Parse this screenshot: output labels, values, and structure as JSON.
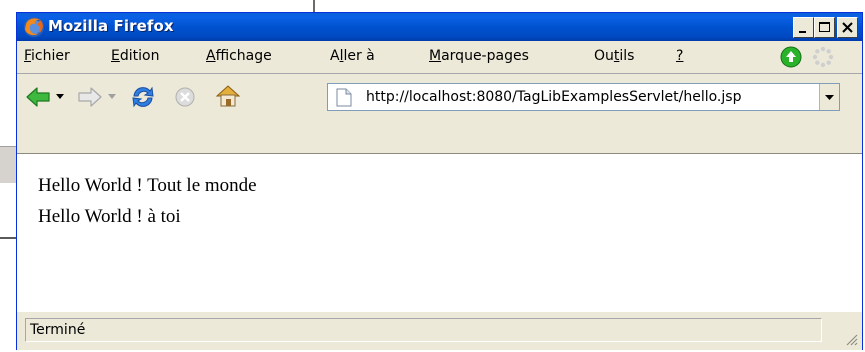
{
  "window": {
    "title": "Mozilla Firefox"
  },
  "menu": {
    "items": [
      {
        "pre": "",
        "u": "F",
        "post": "ichier"
      },
      {
        "pre": "",
        "u": "E",
        "post": "dition"
      },
      {
        "pre": "",
        "u": "A",
        "post": "ffichage"
      },
      {
        "pre": "A",
        "u": "l",
        "post": "ler à"
      },
      {
        "pre": "",
        "u": "M",
        "post": "arque-pages"
      },
      {
        "pre": "Ou",
        "u": "t",
        "post": "ils"
      },
      {
        "pre": "",
        "u": "?",
        "post": ""
      }
    ]
  },
  "navigation": {
    "url": "http://localhost:8080/TagLibExamplesServlet/hello.jsp"
  },
  "content": {
    "lines": [
      "Hello World ! Tout le monde",
      "Hello World ! à toi"
    ]
  },
  "status": {
    "text": "Terminé"
  },
  "colors": {
    "titlebar": "#0054e3",
    "chrome": "#ece9d8",
    "update_green": "#2bb22b"
  }
}
